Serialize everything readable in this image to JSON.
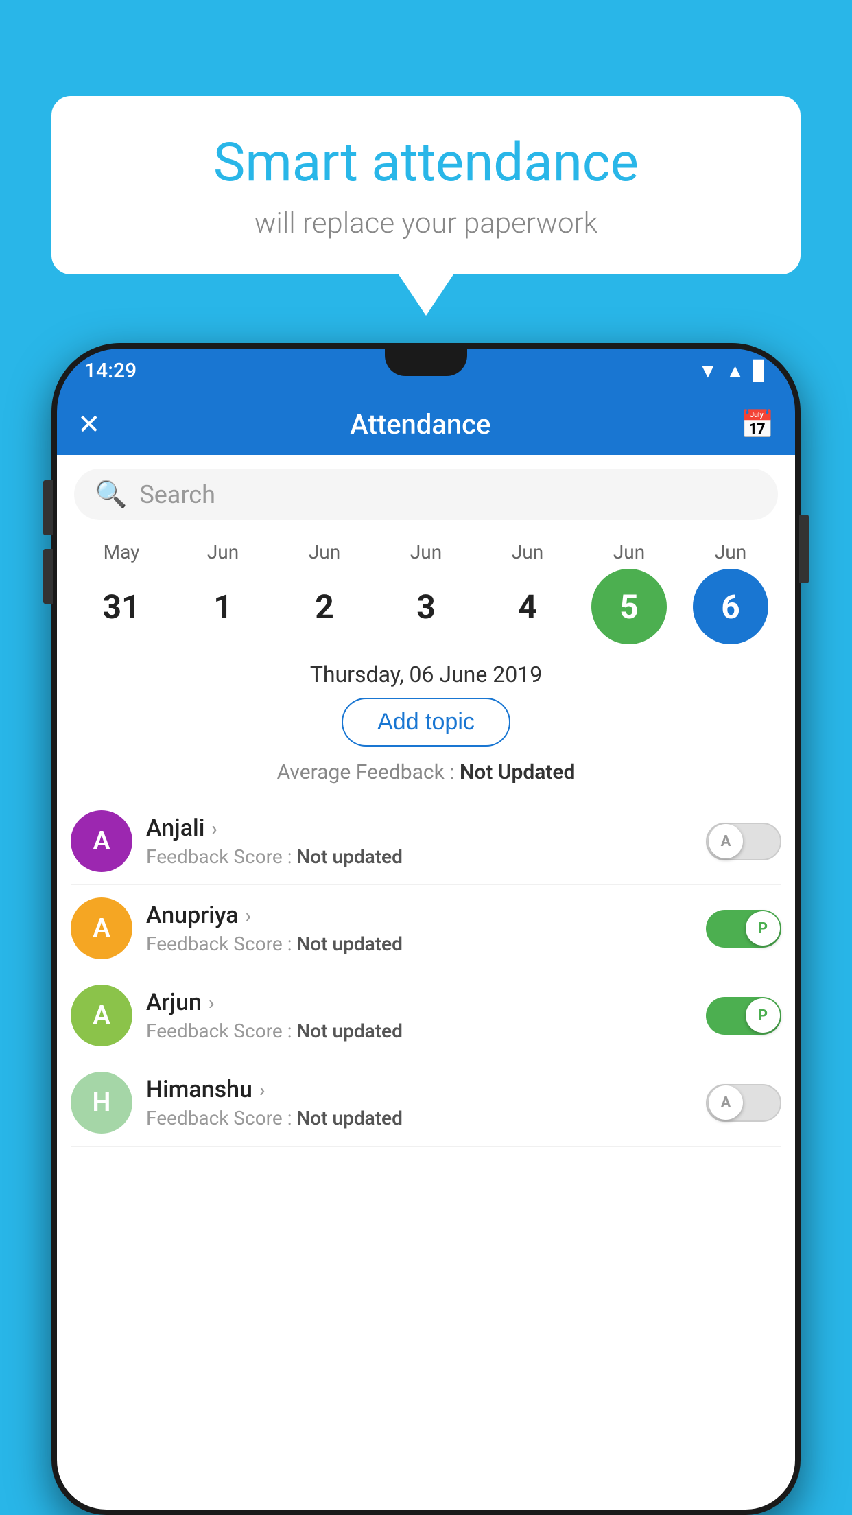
{
  "background_color": "#29b6e8",
  "speech_bubble": {
    "title": "Smart attendance",
    "subtitle": "will replace your paperwork"
  },
  "status_bar": {
    "time": "14:29",
    "wifi_icon": "▲",
    "signal_icon": "▲",
    "battery_icon": "▊"
  },
  "app_bar": {
    "close_icon": "✕",
    "title": "Attendance",
    "calendar_icon": "📅"
  },
  "search": {
    "placeholder": "Search"
  },
  "calendar": {
    "days": [
      {
        "month": "May",
        "date": "31",
        "style": "normal"
      },
      {
        "month": "Jun",
        "date": "1",
        "style": "normal"
      },
      {
        "month": "Jun",
        "date": "2",
        "style": "normal"
      },
      {
        "month": "Jun",
        "date": "3",
        "style": "normal"
      },
      {
        "month": "Jun",
        "date": "4",
        "style": "normal"
      },
      {
        "month": "Jun",
        "date": "5",
        "style": "today"
      },
      {
        "month": "Jun",
        "date": "6",
        "style": "selected"
      }
    ]
  },
  "selected_date_label": "Thursday, 06 June 2019",
  "add_topic_label": "Add topic",
  "avg_feedback_label": "Average Feedback :",
  "avg_feedback_value": "Not Updated",
  "students": [
    {
      "name": "Anjali",
      "avatar_letter": "A",
      "avatar_color": "#9c27b0",
      "feedback_label": "Feedback Score :",
      "feedback_value": "Not updated",
      "toggle": "off",
      "toggle_letter": "A"
    },
    {
      "name": "Anupriya",
      "avatar_letter": "A",
      "avatar_color": "#f5a623",
      "feedback_label": "Feedback Score :",
      "feedback_value": "Not updated",
      "toggle": "on",
      "toggle_letter": "P"
    },
    {
      "name": "Arjun",
      "avatar_letter": "A",
      "avatar_color": "#8bc34a",
      "feedback_label": "Feedback Score :",
      "feedback_value": "Not updated",
      "toggle": "on",
      "toggle_letter": "P"
    },
    {
      "name": "Himanshu",
      "avatar_letter": "H",
      "avatar_color": "#a5d6a7",
      "feedback_label": "Feedback Score :",
      "feedback_value": "Not updated",
      "toggle": "off",
      "toggle_letter": "A"
    }
  ]
}
